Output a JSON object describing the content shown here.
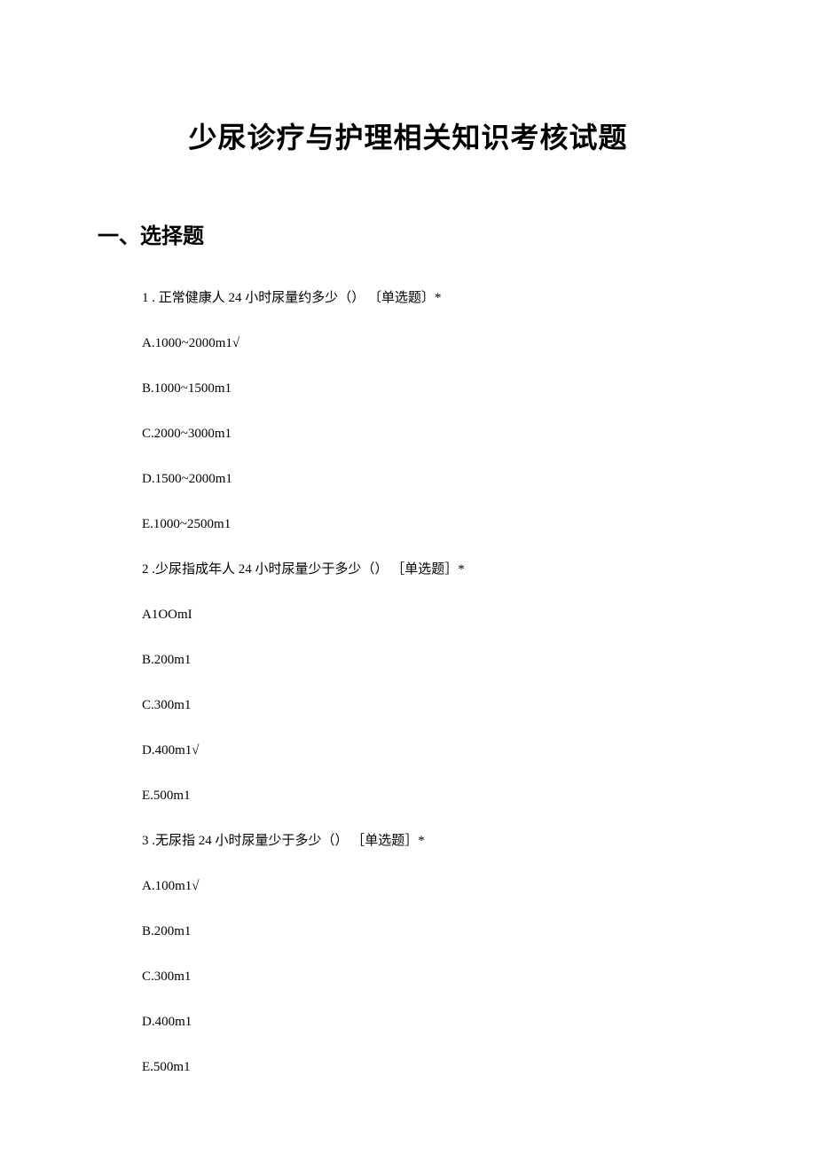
{
  "title": "少尿诊疗与护理相关知识考核试题",
  "section_header": "一、选择题",
  "questions": [
    {
      "num": "1",
      "stem": ". 正常健康人 24 小时尿量约多少（） 〔单选题〕*",
      "options": [
        "A.1000~2000m1√",
        "B.1000~1500m1",
        "C.2000~3000m1",
        "D.1500~2000m1",
        "E.1000~2500m1"
      ]
    },
    {
      "num": "2",
      "stem": " .少尿指成年人 24 小时尿量少于多少（） ［单选题］*",
      "options": [
        "A1OOmI",
        "B.200m1",
        "C.300m1",
        "D.400m1√",
        "E.500m1"
      ]
    },
    {
      "num": "3",
      "stem": "  .无尿指 24 小时尿量少于多少（） ［单选题］*",
      "options": [
        "A.100m1√",
        "B.200m1",
        "C.300m1",
        "D.400m1",
        "E.500m1"
      ]
    }
  ]
}
